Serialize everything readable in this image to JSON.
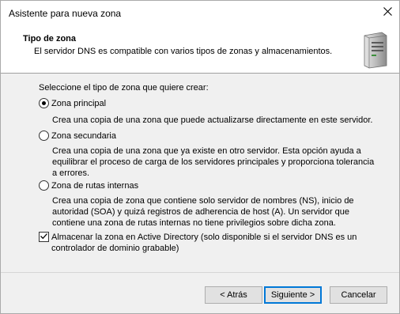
{
  "window": {
    "title": "Asistente para nueva zona"
  },
  "header": {
    "title": "Tipo de zona",
    "subtitle": "El servidor DNS es compatible con varios tipos de zonas y almacenamientos."
  },
  "content": {
    "prompt": "Seleccione el tipo de zona que quiere crear:",
    "options": [
      {
        "label": "Zona principal",
        "checked": true,
        "description": "Crea una copia de una zona que puede actualizarse directamente en este servidor."
      },
      {
        "label": "Zona secundaria",
        "checked": false,
        "description": "Crea una copia de una zona que ya existe en otro servidor. Esta opción ayuda a equilibrar el proceso de carga de los servidores principales y proporciona tolerancia a errores."
      },
      {
        "label": "Zona de rutas internas",
        "checked": false,
        "description": "Crea una copia de zona que contiene solo servidor de nombres (NS), inicio de autoridad (SOA) y quizá registros de adherencia de host (A). Un servidor que contiene una zona de rutas internas no tiene privilegios sobre dicha zona."
      }
    ],
    "ad_checkbox": {
      "label": "Almacenar la zona en Active Directory (solo disponible si el servidor DNS es un controlador de dominio grabable)",
      "checked": true
    }
  },
  "buttons": {
    "back": "< Atrás",
    "next": "Siguiente >",
    "cancel": "Cancelar"
  },
  "icons": {
    "close": "close-icon",
    "server": "server-icon",
    "check": "checkmark-icon"
  },
  "colors": {
    "accent": "#0078d7",
    "dialog_bg": "#f0f0f0",
    "header_bg": "#ffffff"
  }
}
